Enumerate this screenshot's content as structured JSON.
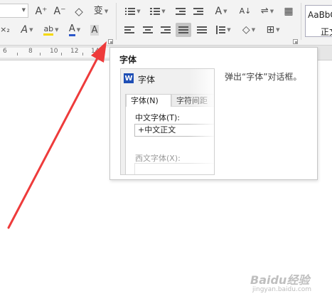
{
  "ribbon": {
    "row1": [
      {
        "name": "grow-font-icon",
        "label": "A⁺"
      },
      {
        "name": "shrink-font-icon",
        "label": "A⁻"
      },
      {
        "name": "clear-format-icon",
        "label": "◇"
      },
      {
        "name": "phonetic-guide-icon",
        "label": "变"
      },
      {
        "name": "bullets-icon",
        "label": ""
      },
      {
        "name": "numbering-icon",
        "label": ""
      },
      {
        "name": "decrease-indent-icon",
        "label": ""
      },
      {
        "name": "increase-indent-icon",
        "label": ""
      },
      {
        "name": "text-direction-icon",
        "label": "A"
      },
      {
        "name": "sort-icon",
        "label": "A↓"
      },
      {
        "name": "line-spacing-options-icon",
        "label": "⇌"
      },
      {
        "name": "table-icon",
        "label": "▦"
      }
    ],
    "row2": [
      {
        "name": "text-effect-icon",
        "label": "A"
      },
      {
        "name": "highlight-icon",
        "label": "ab"
      },
      {
        "name": "font-color-icon",
        "label": "A"
      },
      {
        "name": "char-shading-icon",
        "label": "A"
      },
      {
        "name": "align-left-icon",
        "label": ""
      },
      {
        "name": "align-center-icon",
        "label": ""
      },
      {
        "name": "align-right-icon",
        "label": ""
      },
      {
        "name": "justify-icon",
        "label": ""
      },
      {
        "name": "distribute-icon",
        "label": ""
      },
      {
        "name": "line-spacing-icon",
        "label": ""
      },
      {
        "name": "shading-icon",
        "label": "◇"
      },
      {
        "name": "borders-icon",
        "label": "⊞"
      }
    ],
    "style_gallery": {
      "sample": "AaBbC",
      "name": "正文"
    }
  },
  "ruler": {
    "labels": [
      "6",
      "8",
      "10",
      "12",
      "14"
    ]
  },
  "tooltip": {
    "title": "字体",
    "description": "弹出“字体”对话框。",
    "preview": {
      "app_logo": "W",
      "dialog_title": "字体",
      "tabs": [
        "字体(N)",
        "字符间距"
      ],
      "cn_font_label": "中文字体(T):",
      "cn_font_value": "+中文正文",
      "west_font_label": "西文字体(X):"
    }
  },
  "colors": {
    "highlight": "#f5d800",
    "font_color": "#2b57c9",
    "arrow": "#ee3b3b"
  },
  "watermark": {
    "brand": "Baidu经验",
    "url": "jingyan.baidu.com"
  }
}
